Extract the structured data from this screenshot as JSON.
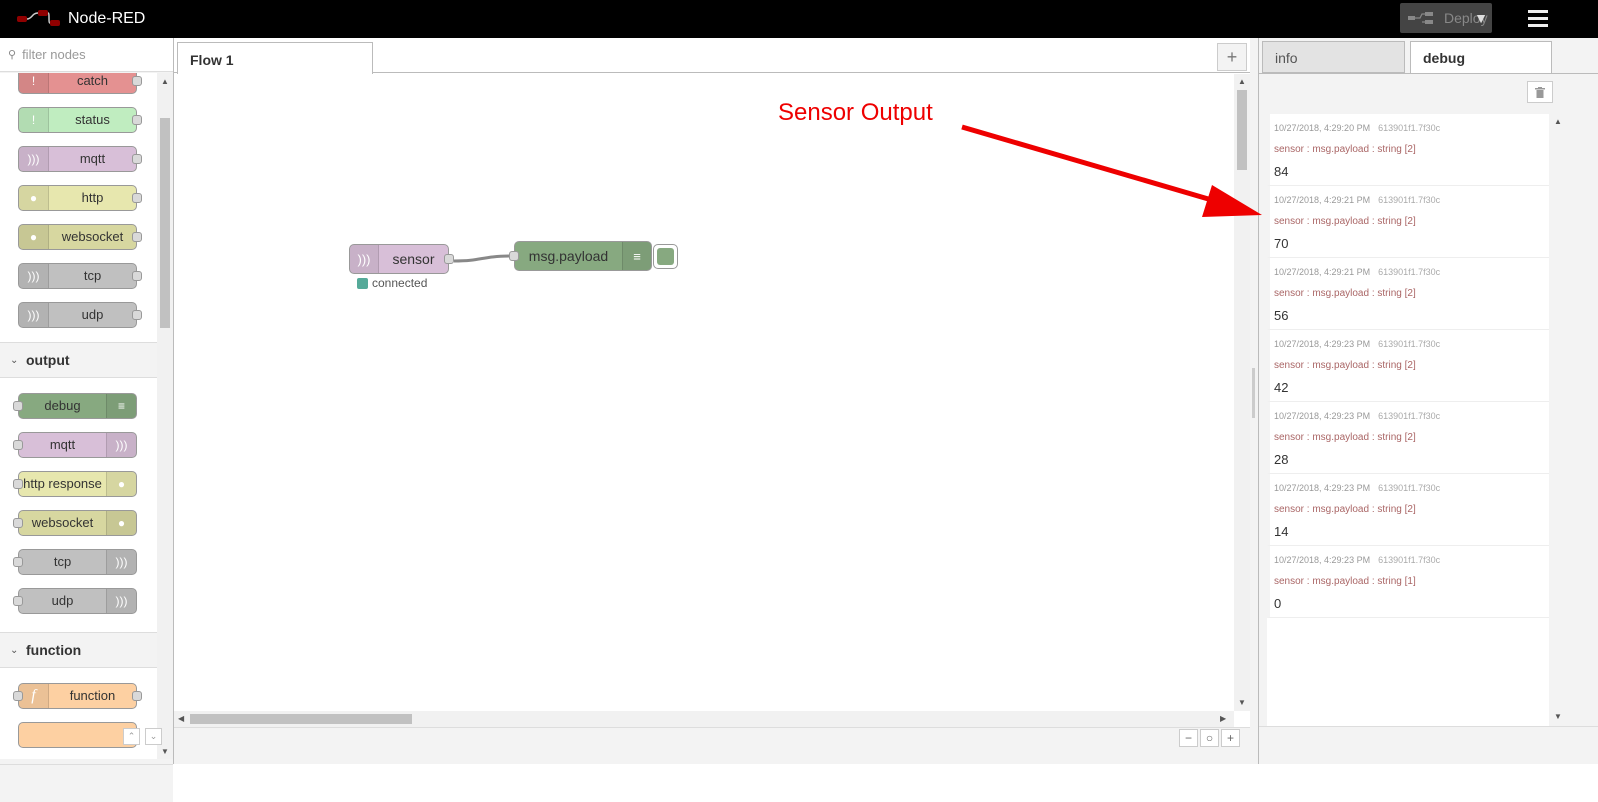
{
  "header": {
    "app_title": "Node-RED",
    "deploy_label": "Deploy"
  },
  "palette": {
    "search_placeholder": "filter nodes",
    "categories": [
      {
        "name": "",
        "nodes": [
          {
            "label": "catch",
            "color": "#e49191",
            "icon": "!"
          },
          {
            "label": "status",
            "color": "#c0edc0",
            "icon": "!"
          },
          {
            "label": "mqtt",
            "color": "#d8bfd8",
            "icon": ")))"
          },
          {
            "label": "http",
            "color": "#e7e7ae",
            "icon": "globe"
          },
          {
            "label": "websocket",
            "color": "#d7d7a0",
            "icon": "globe"
          },
          {
            "label": "tcp",
            "color": "#c0c0c0",
            "icon": ")))"
          },
          {
            "label": "udp",
            "color": "#c0c0c0",
            "icon": ")))"
          }
        ]
      },
      {
        "name": "output",
        "nodes": [
          {
            "label": "debug",
            "color": "#87a980",
            "icon": "list"
          },
          {
            "label": "mqtt",
            "color": "#d8bfd8",
            "icon": ")))"
          },
          {
            "label": "http response",
            "color": "#e7e7ae",
            "icon": "globe"
          },
          {
            "label": "websocket",
            "color": "#d7d7a0",
            "icon": "globe"
          },
          {
            "label": "tcp",
            "color": "#c0c0c0",
            "icon": ")))"
          },
          {
            "label": "udp",
            "color": "#c0c0c0",
            "icon": ")))"
          }
        ]
      },
      {
        "name": "function",
        "nodes": [
          {
            "label": "function",
            "color": "#fdd0a2",
            "icon": "f"
          }
        ]
      }
    ]
  },
  "workspace": {
    "tabs": [
      "Flow 1"
    ],
    "flow_nodes": [
      {
        "label": "sensor",
        "type": "mqtt in",
        "color": "#d8bfd8",
        "status": "connected",
        "status_color": "#5a9"
      },
      {
        "label": "msg.payload",
        "type": "debug",
        "color": "#87a980"
      }
    ]
  },
  "sidebar": {
    "tabs": [
      "info",
      "debug"
    ],
    "active_tab": "debug",
    "messages": [
      {
        "time": "10/27/2018, 4:29:20 PM",
        "node_id": "613901f1.7f30c",
        "topic": "sensor : msg.payload : string [2]",
        "value": "84"
      },
      {
        "time": "10/27/2018, 4:29:21 PM",
        "node_id": "613901f1.7f30c",
        "topic": "sensor : msg.payload : string [2]",
        "value": "70"
      },
      {
        "time": "10/27/2018, 4:29:21 PM",
        "node_id": "613901f1.7f30c",
        "topic": "sensor : msg.payload : string [2]",
        "value": "56"
      },
      {
        "time": "10/27/2018, 4:29:23 PM",
        "node_id": "613901f1.7f30c",
        "topic": "sensor : msg.payload : string [2]",
        "value": "42"
      },
      {
        "time": "10/27/2018, 4:29:23 PM",
        "node_id": "613901f1.7f30c",
        "topic": "sensor : msg.payload : string [2]",
        "value": "28"
      },
      {
        "time": "10/27/2018, 4:29:23 PM",
        "node_id": "613901f1.7f30c",
        "topic": "sensor : msg.payload : string [2]",
        "value": "14"
      },
      {
        "time": "10/27/2018, 4:29:23 PM",
        "node_id": "613901f1.7f30c",
        "topic": "sensor : msg.payload : string [1]",
        "value": "0"
      }
    ]
  },
  "annotation": {
    "text": "Sensor Output",
    "color": "#e00000"
  }
}
